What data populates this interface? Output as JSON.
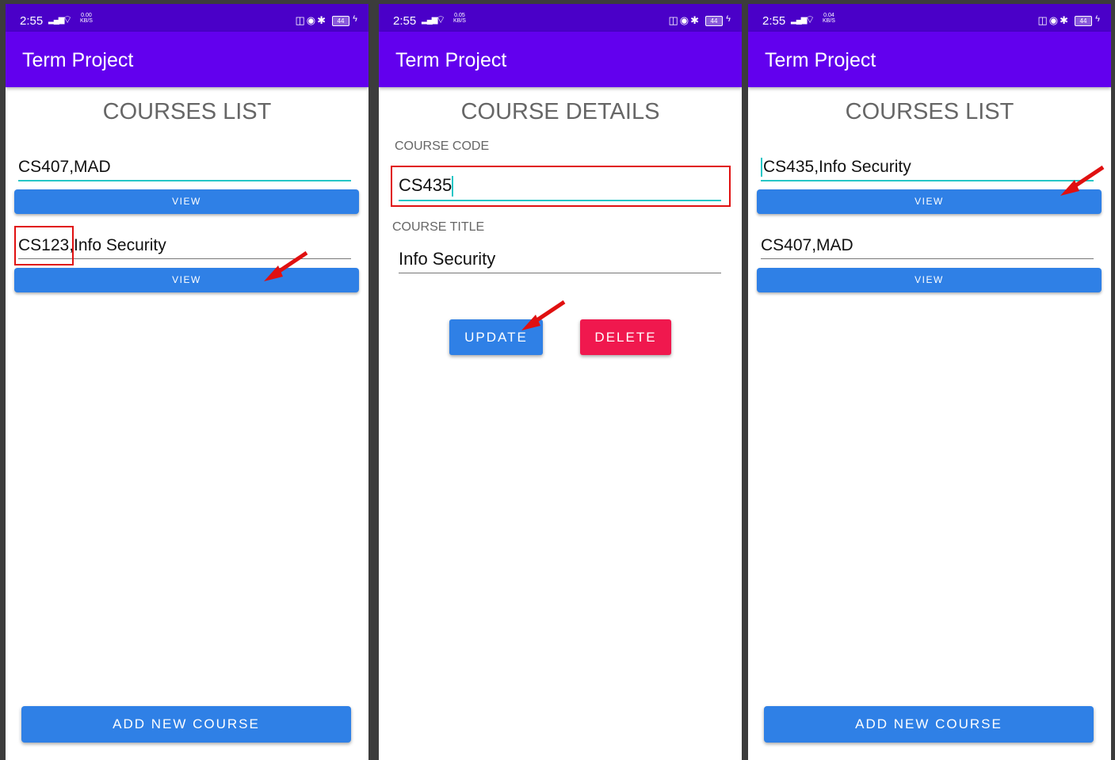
{
  "screens": [
    {
      "status": {
        "time": "2:55",
        "netspeed_value": "0.00",
        "netspeed_unit": "KB/S",
        "battery": "44"
      },
      "app_title": "Term Project",
      "heading": "COURSES LIST",
      "courses": [
        {
          "text": "CS407,MAD",
          "view_label": "VIEW"
        },
        {
          "text": "CS123,Info Security",
          "view_label": "VIEW"
        }
      ],
      "add_button_label": "ADD NEW COURSE"
    },
    {
      "status": {
        "time": "2:55",
        "netspeed_value": "0.05",
        "netspeed_unit": "KB/S",
        "battery": "44"
      },
      "app_title": "Term Project",
      "heading": "COURSE DETAILS",
      "course_code_label": "COURSE CODE",
      "course_code_value": "CS435",
      "course_title_label": "COURSE TITLE",
      "course_title_value": "Info Security",
      "update_label": "UPDATE",
      "delete_label": "DELETE"
    },
    {
      "status": {
        "time": "2:55",
        "netspeed_value": "0.04",
        "netspeed_unit": "KB/S",
        "battery": "44"
      },
      "app_title": "Term Project",
      "heading": "COURSES LIST",
      "courses": [
        {
          "text": "CS435,Info Security",
          "view_label": "VIEW"
        },
        {
          "text": "CS407,MAD",
          "view_label": "VIEW"
        }
      ],
      "add_button_label": "ADD NEW COURSE"
    }
  ],
  "colors": {
    "status_bar": "#4a00c8",
    "app_bar": "#6200ee",
    "primary_button": "#2f80e6",
    "delete_button": "#f0184e",
    "annotation": "#e01010",
    "field_accent": "#26c6c6"
  },
  "icons": [
    "signal-icon",
    "wifi-icon",
    "vibrate-icon",
    "alarm-icon",
    "bluetooth-icon",
    "battery-icon",
    "charging-icon",
    "arrow-annotation-icon"
  ]
}
